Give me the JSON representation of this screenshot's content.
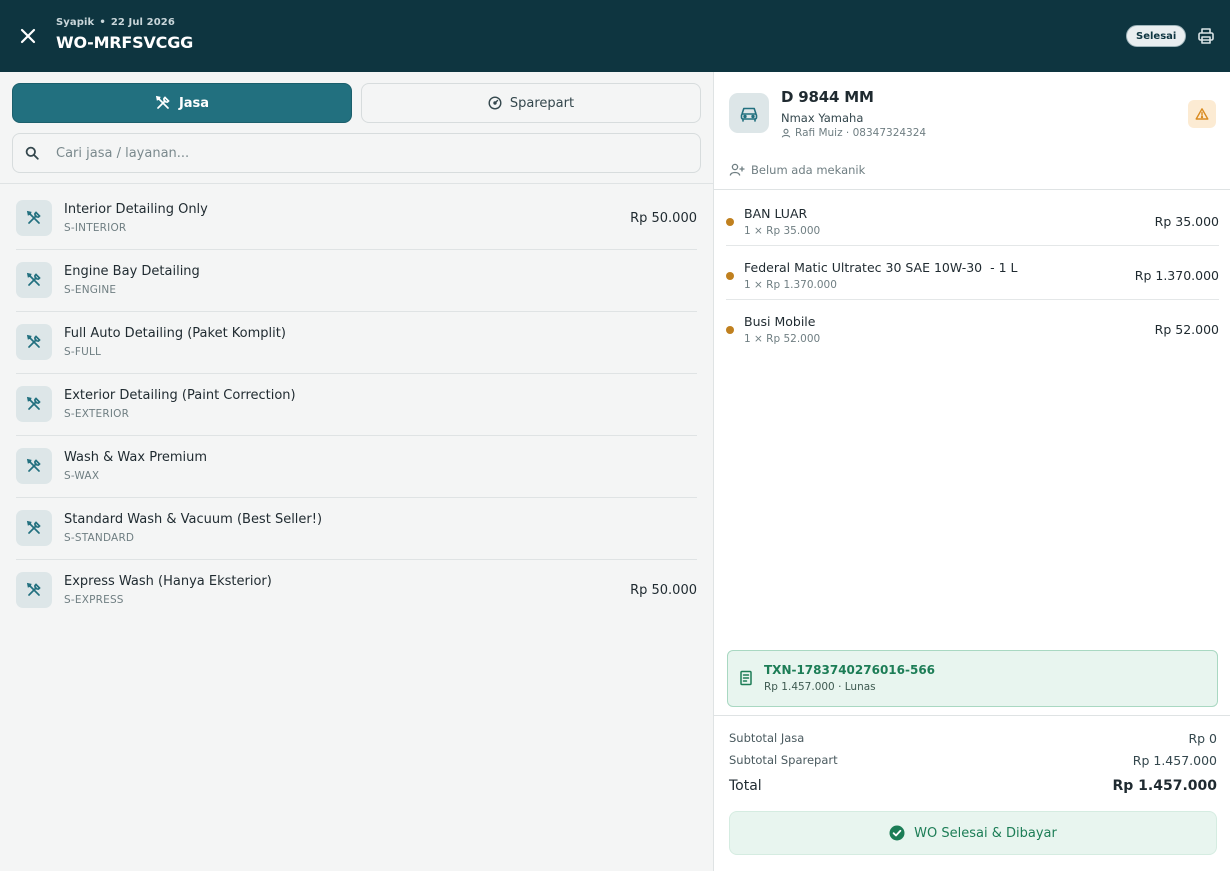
{
  "header": {
    "workshop": "Syapik",
    "separator": "•",
    "date": "22 Jul 2026",
    "wo_number": "WO-MRFSVCGG",
    "status": "Selesai"
  },
  "tabs": {
    "jasa": "Jasa",
    "sparepart": "Sparepart"
  },
  "search": {
    "placeholder": "Cari jasa / layanan..."
  },
  "services": [
    {
      "name": "Interior Detailing Only",
      "code": "S-INTERIOR",
      "price": "Rp 50.000"
    },
    {
      "name": "Engine Bay Detailing",
      "code": "S-ENGINE",
      "price": ""
    },
    {
      "name": "Full Auto Detailing (Paket Komplit)",
      "code": "S-FULL",
      "price": ""
    },
    {
      "name": "Exterior Detailing (Paint Correction)",
      "code": "S-EXTERIOR",
      "price": ""
    },
    {
      "name": "Wash & Wax Premium",
      "code": "S-WAX",
      "price": ""
    },
    {
      "name": "Standard Wash & Vacuum (Best Seller!)",
      "code": "S-STANDARD",
      "price": ""
    },
    {
      "name": "Express Wash (Hanya Eksterior)",
      "code": "S-EXPRESS",
      "price": "Rp 50.000"
    }
  ],
  "vehicle": {
    "plate": "D 9844 MM",
    "model": "Nmax Yamaha",
    "owner": "Rafi Muiz · 08347324324",
    "mechanic": "Belum ada mekanik"
  },
  "items": [
    {
      "name": "BAN LUAR",
      "qty": "1 × Rp 35.000",
      "price": "Rp 35.000"
    },
    {
      "name": "Federal Matic Ultratec 30 SAE 10W-30  - 1 L",
      "qty": "1 × Rp 1.370.000",
      "price": "Rp 1.370.000"
    },
    {
      "name": "Busi Mobile",
      "qty": "1 × Rp 52.000",
      "price": "Rp 52.000"
    }
  ],
  "transaction": {
    "id": "TXN-1783740276016-566",
    "summary": "Rp 1.457.000 · Lunas"
  },
  "totals": {
    "subtotal_jasa_label": "Subtotal Jasa",
    "subtotal_jasa": "Rp 0",
    "subtotal_sparepart_label": "Subtotal Sparepart",
    "subtotal_sparepart": "Rp 1.457.000",
    "total_label": "Total",
    "total": "Rp 1.457.000"
  },
  "done_button": "WO Selesai & Dibayar",
  "colors": {
    "header_bg": "#0e3540",
    "accent": "#22707f",
    "success": "#1c7d56",
    "item_dot": "#c0801f",
    "warning": "#d98a1f"
  }
}
